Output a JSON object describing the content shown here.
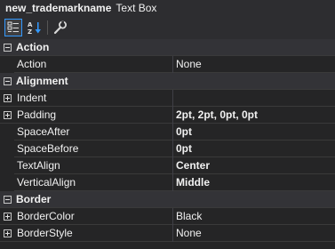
{
  "header": {
    "object_name": "new_trademarkname",
    "object_type": "Text Box"
  },
  "toolbar": {
    "buttons": [
      "categorized-icon",
      "alphabetical-icon",
      "property-pages-icon"
    ]
  },
  "grid": {
    "categories": [
      {
        "label": "Action",
        "properties": [
          {
            "name": "Action",
            "value": "None",
            "bold": false,
            "expandable": false
          }
        ]
      },
      {
        "label": "Alignment",
        "properties": [
          {
            "name": "Indent",
            "value": "",
            "bold": false,
            "expandable": true
          },
          {
            "name": "Padding",
            "value": "2pt, 2pt, 0pt, 0pt",
            "bold": true,
            "expandable": true
          },
          {
            "name": "SpaceAfter",
            "value": "0pt",
            "bold": true,
            "expandable": false
          },
          {
            "name": "SpaceBefore",
            "value": "0pt",
            "bold": true,
            "expandable": false
          },
          {
            "name": "TextAlign",
            "value": "Center",
            "bold": true,
            "expandable": false
          },
          {
            "name": "VerticalAlign",
            "value": "Middle",
            "bold": true,
            "expandable": false
          }
        ]
      },
      {
        "label": "Border",
        "properties": [
          {
            "name": "BorderColor",
            "value": "Black",
            "bold": false,
            "expandable": true
          },
          {
            "name": "BorderStyle",
            "value": "None",
            "bold": false,
            "expandable": true
          }
        ]
      }
    ]
  }
}
